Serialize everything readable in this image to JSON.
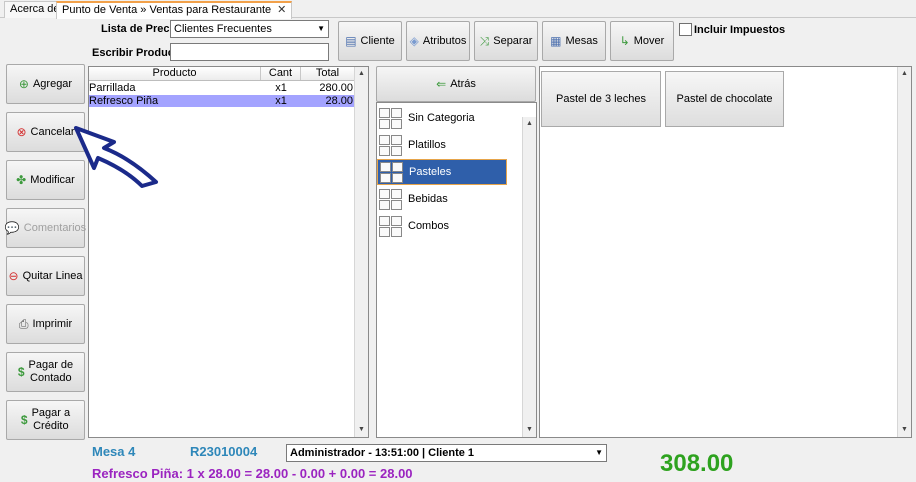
{
  "tabs": [
    {
      "label": "Acerca de"
    },
    {
      "label": "Punto de Venta » Ventas para Restaurante"
    }
  ],
  "top": {
    "price_list_label": "Lista de Precios",
    "price_list_value": "Clientes Frecuentes",
    "write_product_label": "Escribir Producto",
    "write_product_value": ""
  },
  "toolbar": {
    "cliente": "Cliente",
    "atributos": "Atributos",
    "separar": "Separar",
    "mesas": "Mesas",
    "mover": "Mover",
    "include_taxes": "Incluir Impuestos"
  },
  "sidebar": {
    "agregar": "Agregar",
    "cancelar": "Cancelar",
    "modificar": "Modificar",
    "comentarios": "Comentarios",
    "quitar": "Quitar Linea",
    "imprimir": "Imprimir",
    "pagar_contado_1": "Pagar de",
    "pagar_contado_2": "Contado",
    "pagar_credito_1": "Pagar a",
    "pagar_credito_2": "Crédito"
  },
  "order_table": {
    "headers": {
      "producto": "Producto",
      "cant": "Cant",
      "total": "Total"
    },
    "rows": [
      {
        "producto": "Parrillada",
        "cant": "x1",
        "total": "280.00"
      },
      {
        "producto": "Refresco Piña",
        "cant": "x1",
        "total": "28.00"
      }
    ]
  },
  "categories": {
    "back": "Atrás",
    "items": [
      {
        "label": "Sin Categoria"
      },
      {
        "label": "Platillos"
      },
      {
        "label": "Pasteles"
      },
      {
        "label": "Bebidas"
      },
      {
        "label": "Combos"
      }
    ]
  },
  "products": [
    {
      "label": "Pastel de 3 leches"
    },
    {
      "label": "Pastel de chocolate"
    }
  ],
  "status": {
    "mesa": "Mesa 4",
    "code": "R23010004",
    "session": "Administrador - 13:51:00 | Cliente 1",
    "summary": "Refresco Piña: 1 x 28.00 = 28.00 - 0.00 + 0.00 = 28.00",
    "total": "308.00"
  },
  "colors": {
    "selected_row": "#a3a3ff",
    "selected_category": "#2f5faa",
    "total_green": "#2ea21f",
    "info_blue": "#2e87b9",
    "summary_purple": "#9b24c0",
    "arrow_navy": "#1b2a8a"
  }
}
